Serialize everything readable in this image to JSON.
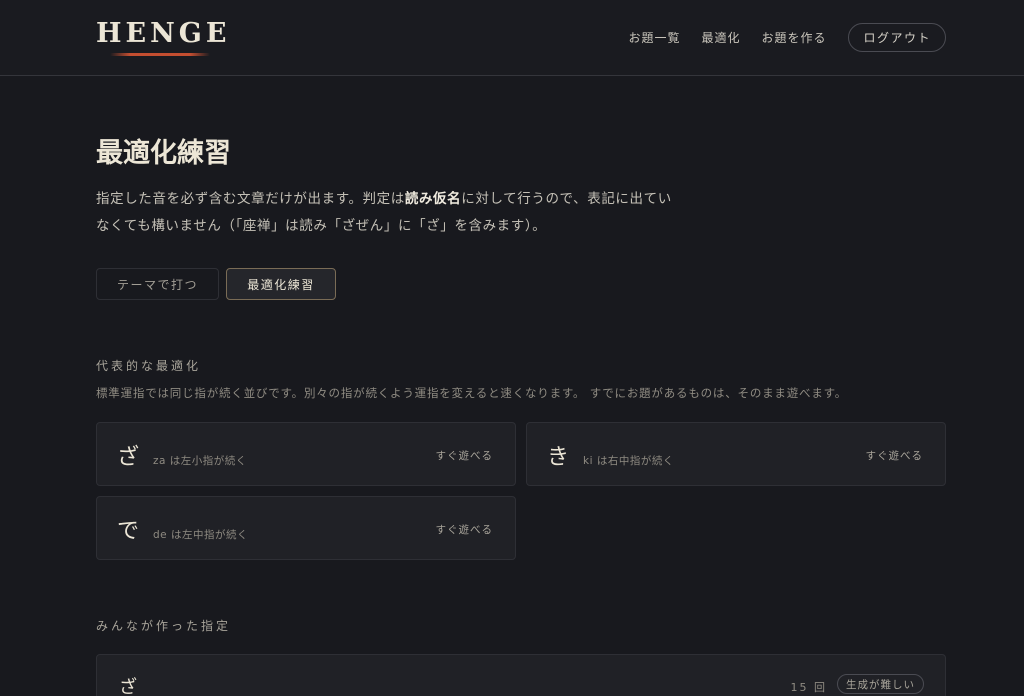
{
  "header": {
    "logo": "HENGE",
    "nav": [
      "お題一覧",
      "最適化",
      "お題を作る"
    ],
    "logout": "ログアウト"
  },
  "page": {
    "title": "最適化練習",
    "desc_part1": "指定した音を必ず含む文章だけが出ます。判定は",
    "desc_bold": "読み仮名",
    "desc_part2": "に対して行うので、表記に出てい",
    "desc_line2": "なくても構いません（「座禅」は読み「ざぜん」に「ざ」を含みます）。"
  },
  "tabs": {
    "theme": "テーマで打つ",
    "optimize": "最適化練習"
  },
  "featured": {
    "heading": "代表的な最適化",
    "subtext": "標準運指では同じ指が続く並びです。別々の指が続くよう運指を変えると速くなります。 すでにお題があるものは、そのまま遊べます。",
    "cards": [
      {
        "kana": "ざ",
        "desc": "za は左小指が続く",
        "action": "すぐ遊べる"
      },
      {
        "kana": "き",
        "desc": "ki は右中指が続く",
        "action": "すぐ遊べる"
      },
      {
        "kana": "で",
        "desc": "de は左中指が続く",
        "action": "すぐ遊べる"
      }
    ]
  },
  "community": {
    "heading": "みんなが作った指定",
    "items": [
      {
        "kana": "ざ",
        "count": "15 回",
        "badge": "生成が難しい"
      }
    ]
  }
}
